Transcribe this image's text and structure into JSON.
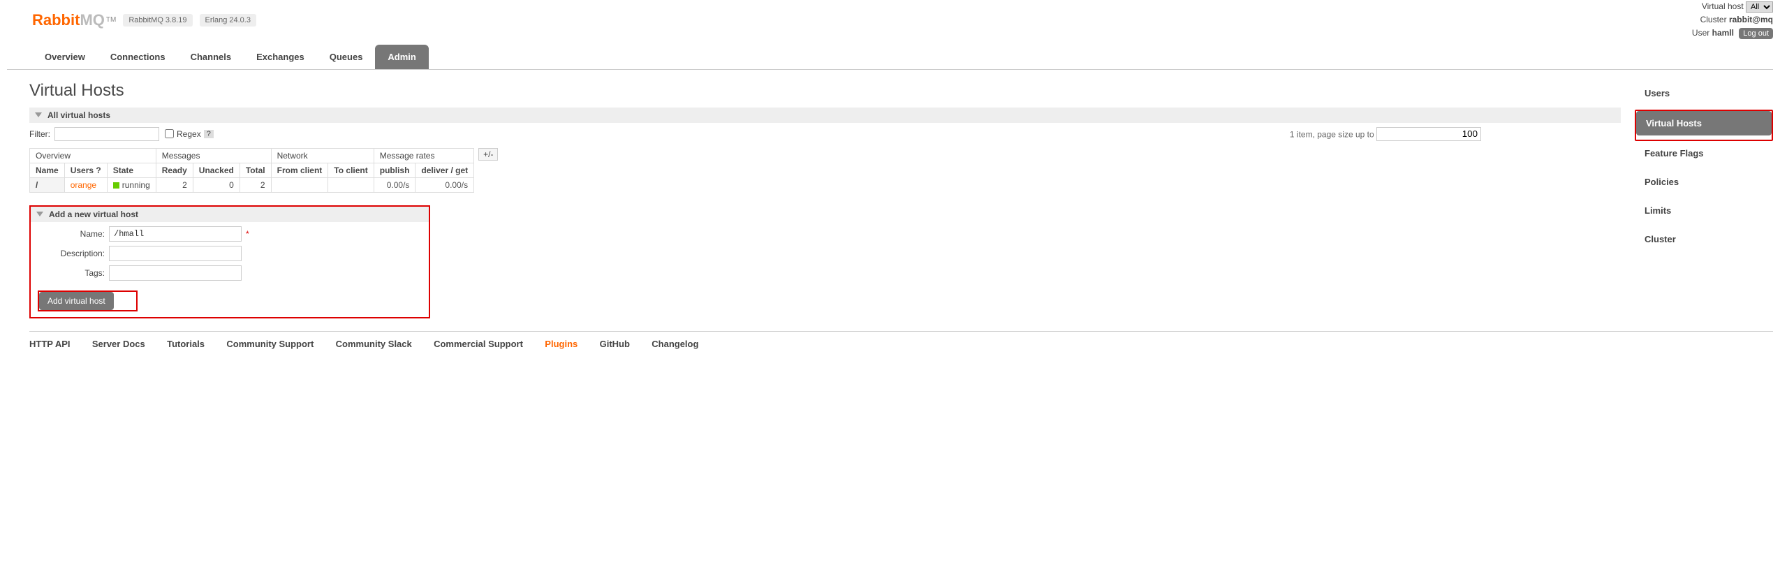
{
  "header": {
    "logo_prefix": "Rabbit",
    "logo_suffix": "MQ",
    "tm": "TM",
    "rabbit_version": "RabbitMQ 3.8.19",
    "erlang_version": "Erlang 24.0.3",
    "vh_label": "Virtual host",
    "vh_value": "All",
    "cluster_label": "Cluster",
    "cluster_value": "rabbit@mq",
    "user_label": "User",
    "user_value": "hamll",
    "logout": "Log out"
  },
  "tabs": [
    "Overview",
    "Connections",
    "Channels",
    "Exchanges",
    "Queues",
    "Admin"
  ],
  "page_title": "Virtual Hosts",
  "all_section": "All virtual hosts",
  "filter": {
    "label": "Filter:",
    "value": "",
    "regex_label": "Regex",
    "help": "?",
    "summary_prefix": "1 item, page size up to",
    "page_size": "100"
  },
  "table": {
    "groups": {
      "overview": "Overview",
      "messages": "Messages",
      "network": "Network",
      "rates": "Message rates"
    },
    "cols": {
      "name": "Name",
      "users": "Users",
      "users_help": "?",
      "state": "State",
      "ready": "Ready",
      "unacked": "Unacked",
      "total": "Total",
      "from_client": "From client",
      "to_client": "To client",
      "publish": "publish",
      "deliver_get": "deliver / get"
    },
    "toggle": "+/-",
    "row": {
      "name": "/",
      "user": "orange",
      "state": "running",
      "ready": "2",
      "unacked": "0",
      "total": "2",
      "from_client": "",
      "to_client": "",
      "publish": "0.00/s",
      "deliver_get": "0.00/s"
    }
  },
  "add": {
    "title": "Add a new virtual host",
    "name_label": "Name:",
    "name_value": "/hmall",
    "desc_label": "Description:",
    "desc_value": "",
    "tags_label": "Tags:",
    "tags_value": "",
    "button": "Add virtual host"
  },
  "side_nav": [
    "Users",
    "Virtual Hosts",
    "Feature Flags",
    "Policies",
    "Limits",
    "Cluster"
  ],
  "footer": [
    "HTTP API",
    "Server Docs",
    "Tutorials",
    "Community Support",
    "Community Slack",
    "Commercial Support",
    "Plugins",
    "GitHub",
    "Changelog"
  ]
}
